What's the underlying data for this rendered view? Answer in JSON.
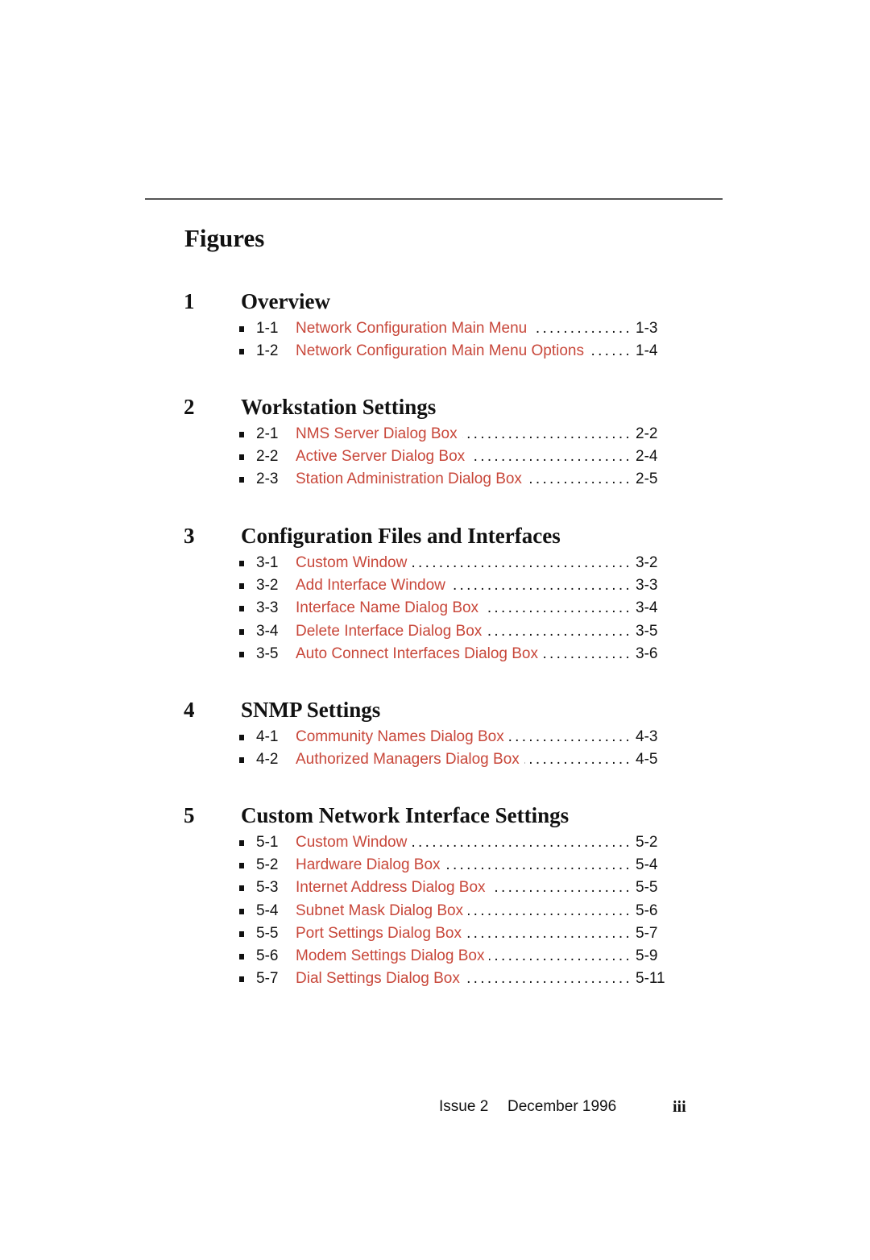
{
  "page_title": "Figures",
  "sections": [
    {
      "number": "1",
      "title": "Overview",
      "figures": [
        {
          "number": "1-1",
          "title": "Network Configuration Main Menu",
          "page": "1-3"
        },
        {
          "number": "1-2",
          "title": "Network Configuration Main Menu Options",
          "page": "1-4"
        }
      ]
    },
    {
      "number": "2",
      "title": "Workstation Settings",
      "figures": [
        {
          "number": "2-1",
          "title": "NMS Server Dialog Box",
          "page": "2-2"
        },
        {
          "number": "2-2",
          "title": "Active Server Dialog Box",
          "page": "2-4"
        },
        {
          "number": "2-3",
          "title": "Station Administration Dialog Box",
          "page": "2-5"
        }
      ]
    },
    {
      "number": "3",
      "title": "Configuration Files and Interfaces",
      "figures": [
        {
          "number": "3-1",
          "title": "Custom Window",
          "page": "3-2"
        },
        {
          "number": "3-2",
          "title": "Add Interface Window",
          "page": "3-3"
        },
        {
          "number": "3-3",
          "title": "Interface Name Dialog Box",
          "page": "3-4"
        },
        {
          "number": "3-4",
          "title": "Delete Interface Dialog Box",
          "page": "3-5"
        },
        {
          "number": "3-5",
          "title": "Auto Connect Interfaces Dialog Box",
          "page": "3-6"
        }
      ]
    },
    {
      "number": "4",
      "title": "SNMP Settings",
      "figures": [
        {
          "number": "4-1",
          "title": "Community Names Dialog Box",
          "page": "4-3"
        },
        {
          "number": "4-2",
          "title": "Authorized Managers Dialog Box",
          "page": "4-5"
        }
      ]
    },
    {
      "number": "5",
      "title": "Custom Network Interface Settings",
      "figures": [
        {
          "number": "5-1",
          "title": "Custom Window",
          "page": "5-2"
        },
        {
          "number": "5-2",
          "title": "Hardware Dialog Box",
          "page": "5-4"
        },
        {
          "number": "5-3",
          "title": "Internet Address Dialog Box",
          "page": "5-5"
        },
        {
          "number": "5-4",
          "title": "Subnet Mask Dialog Box",
          "page": "5-6"
        },
        {
          "number": "5-5",
          "title": "Port Settings Dialog Box",
          "page": "5-7"
        },
        {
          "number": "5-6",
          "title": "Modem Settings Dialog Box",
          "page": "5-9"
        },
        {
          "number": "5-7",
          "title": "Dial Settings Dialog Box",
          "page": "5-11"
        }
      ]
    }
  ],
  "footer": {
    "issue": "Issue 2",
    "date": "December 1996",
    "page_number": "iii"
  },
  "colors": {
    "link": "#c8473a",
    "text": "#111111",
    "rule": "#555555"
  }
}
